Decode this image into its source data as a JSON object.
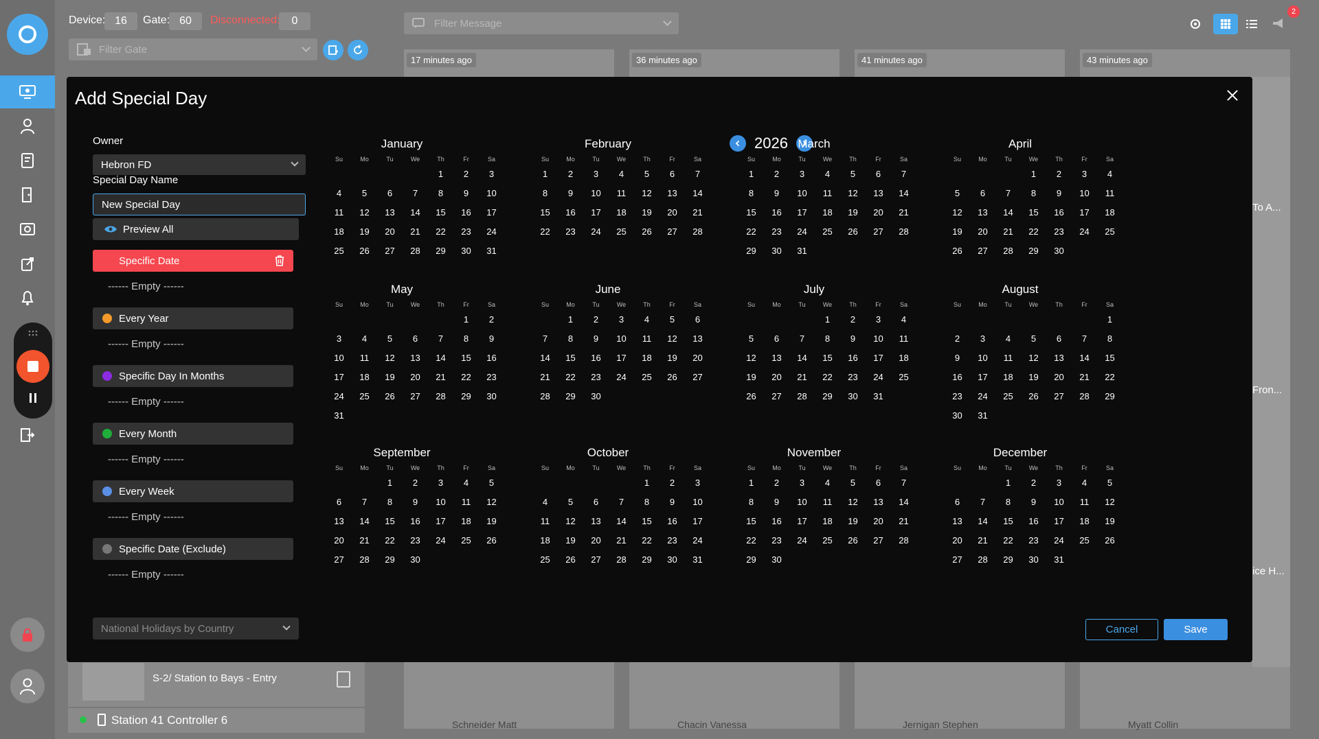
{
  "topbar": {
    "device_label": "Device:",
    "device_value": "16",
    "gate_label": "Gate:",
    "gate_value": "60",
    "disconnected_label": "Disconnected:",
    "disconnected_value": "0",
    "filter_gate_placeholder": "Filter Gate",
    "filter_message_placeholder": "Filter Message",
    "notification_count": "2"
  },
  "background": {
    "card_times": [
      "17 minutes ago",
      "36 minutes ago",
      "41 minutes ago",
      "43 minutes ago"
    ],
    "side_snippets": [
      "To A...",
      "Fron...",
      "ice H..."
    ],
    "station_entry": "S-2/ Station to Bays - Entry",
    "controller": "Station 41 Controller 6",
    "bottom_names": [
      "Schneider Matt",
      "Chacin Vanessa",
      "Jernigan Stephen",
      "Myatt Collin"
    ]
  },
  "modal": {
    "title": "Add Special Day",
    "owner_label": "Owner",
    "owner_value": "Hebron FD",
    "name_label": "Special Day Name",
    "name_value": "New Special Day",
    "preview_label": "Preview All",
    "categories": [
      {
        "label": "Specific Date",
        "color": "#f5474f",
        "empty": "------ Empty ------"
      },
      {
        "label": "Every Year",
        "color": "#f39a2b",
        "empty": "------ Empty ------"
      },
      {
        "label": "Specific Day In Months",
        "color": "#8a2be2",
        "empty": "------ Empty ------"
      },
      {
        "label": "Every Month",
        "color": "#1fae3a",
        "empty": "------ Empty ------"
      },
      {
        "label": "Every Week",
        "color": "#5b8fe6",
        "empty": "------ Empty ------"
      },
      {
        "label": "Specific Date (Exclude)",
        "color": "#777777",
        "empty": "------ Empty ------"
      }
    ],
    "holidays_placeholder": "National Holidays by Country",
    "year": "2026",
    "weekdays": [
      "Su",
      "Mo",
      "Tu",
      "We",
      "Th",
      "Fr",
      "Sa"
    ],
    "months": [
      {
        "name": "January",
        "start": 4,
        "days": 31
      },
      {
        "name": "February",
        "start": 0,
        "days": 28
      },
      {
        "name": "March",
        "start": 0,
        "days": 31
      },
      {
        "name": "April",
        "start": 3,
        "days": 30
      },
      {
        "name": "May",
        "start": 5,
        "days": 31
      },
      {
        "name": "June",
        "start": 1,
        "days": 30
      },
      {
        "name": "July",
        "start": 3,
        "days": 31
      },
      {
        "name": "August",
        "start": 6,
        "days": 31
      },
      {
        "name": "September",
        "start": 2,
        "days": 30
      },
      {
        "name": "October",
        "start": 4,
        "days": 31
      },
      {
        "name": "November",
        "start": 0,
        "days": 30
      },
      {
        "name": "December",
        "start": 2,
        "days": 31
      }
    ],
    "cancel_label": "Cancel",
    "save_label": "Save"
  }
}
